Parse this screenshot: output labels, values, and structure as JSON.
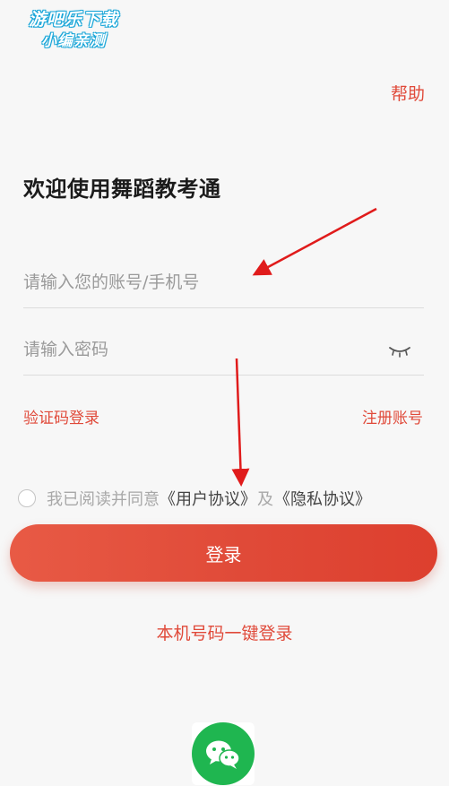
{
  "watermark": {
    "line1": "游吧乐下载",
    "line2": "小编亲测"
  },
  "header": {
    "help_label": "帮助"
  },
  "welcome_title": "欢迎使用舞蹈教考通",
  "account_field": {
    "placeholder": "请输入您的账号/手机号"
  },
  "password_field": {
    "placeholder": "请输入密码"
  },
  "links": {
    "sms_login": "验证码登录",
    "register": "注册账号"
  },
  "agreement": {
    "prefix": "我已阅读并同意",
    "user_agreement": "《用户协议》",
    "conjunction": "及",
    "privacy_agreement": "《隐私协议》"
  },
  "login_button_label": "登录",
  "one_key_login_label": "本机号码一键登录",
  "colors": {
    "accent": "#e04a3a",
    "wechat_green": "#1fb650"
  },
  "icons": {
    "password_toggle": "eye-closed-icon",
    "social": "wechat-icon"
  }
}
